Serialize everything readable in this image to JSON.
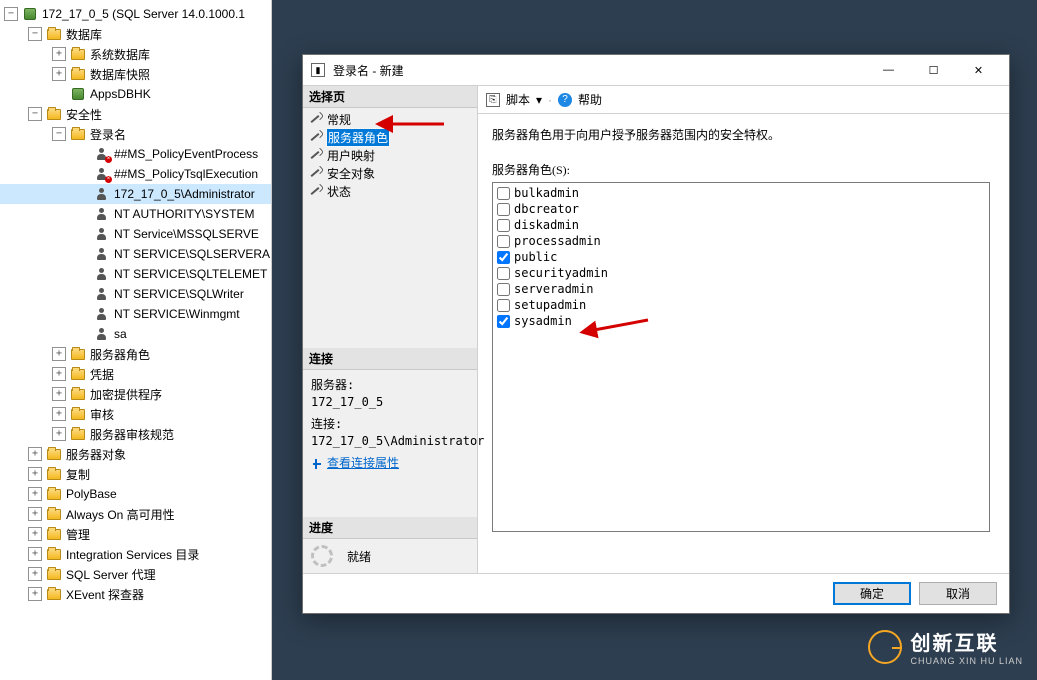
{
  "tree": {
    "root": "172_17_0_5 (SQL Server 14.0.1000.1",
    "db": "数据库",
    "db_children": [
      "系统数据库",
      "数据库快照",
      "AppsDBHK"
    ],
    "security": "安全性",
    "logins": "登录名",
    "login_items": [
      {
        "label": "##MS_PolicyEventProcess",
        "redx": true
      },
      {
        "label": "##MS_PolicyTsqlExecution",
        "redx": true
      },
      {
        "label": "172_17_0_5\\Administrator",
        "redx": false,
        "sel": true
      },
      {
        "label": "NT AUTHORITY\\SYSTEM",
        "redx": false
      },
      {
        "label": "NT Service\\MSSQLSERVE",
        "redx": false
      },
      {
        "label": "NT SERVICE\\SQLSERVERA",
        "redx": false
      },
      {
        "label": "NT SERVICE\\SQLTELEMET",
        "redx": false
      },
      {
        "label": "NT SERVICE\\SQLWriter",
        "redx": false
      },
      {
        "label": "NT SERVICE\\Winmgmt",
        "redx": false
      },
      {
        "label": "sa",
        "redx": false
      }
    ],
    "sec_children": [
      "服务器角色",
      "凭据",
      "加密提供程序",
      "审核",
      "服务器审核规范"
    ],
    "after_security": [
      "服务器对象",
      "复制",
      "PolyBase",
      "Always On 高可用性",
      "管理",
      "Integration Services 目录",
      "SQL Server 代理",
      "XEvent 探查器"
    ]
  },
  "dialog": {
    "title": "登录名 - 新建",
    "select_page": "选择页",
    "pages": [
      "常规",
      "服务器角色",
      "用户映射",
      "安全对象",
      "状态"
    ],
    "selected_page_index": 1,
    "script_label": "脚本",
    "help_label": "帮助",
    "description": "服务器角色用于向用户授予服务器范围内的安全特权。",
    "roles_label": "服务器角色(S):",
    "roles": [
      {
        "name": "bulkadmin",
        "checked": false
      },
      {
        "name": "dbcreator",
        "checked": false
      },
      {
        "name": "diskadmin",
        "checked": false
      },
      {
        "name": "processadmin",
        "checked": false
      },
      {
        "name": "public",
        "checked": true
      },
      {
        "name": "securityadmin",
        "checked": false
      },
      {
        "name": "serveradmin",
        "checked": false
      },
      {
        "name": "setupadmin",
        "checked": false
      },
      {
        "name": "sysadmin",
        "checked": true
      }
    ],
    "connection_header": "连接",
    "server_label": "服务器:",
    "server_value": "172_17_0_5",
    "connect_label": "连接:",
    "connect_value": "172_17_0_5\\Administrator",
    "view_props": "查看连接属性",
    "progress_header": "进度",
    "progress_value": "就绪",
    "ok": "确定",
    "cancel": "取消"
  },
  "watermark": {
    "big": "创新互联",
    "small": "CHUANG XIN HU LIAN"
  }
}
